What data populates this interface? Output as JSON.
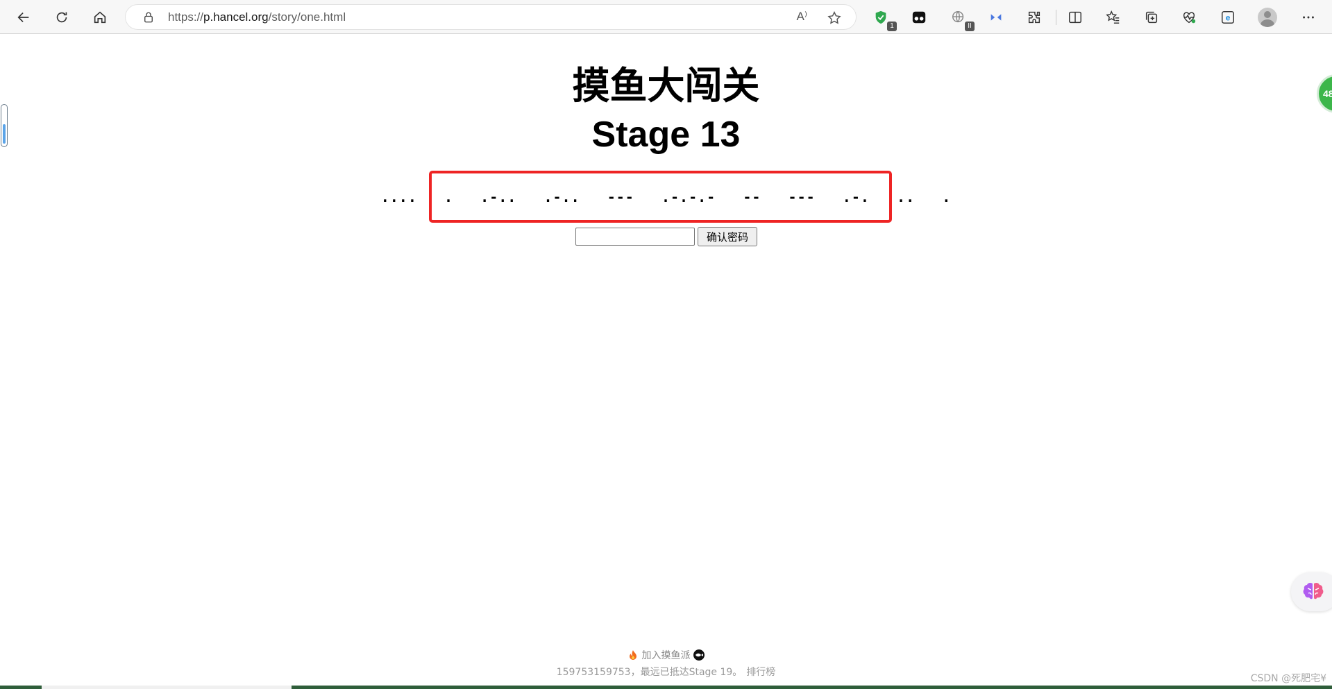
{
  "browser": {
    "url_prefix": "https://",
    "url_host": "p.hancel.org",
    "url_path": "/story/one.html",
    "read_aloud_label": "A⁾",
    "extension_badges": [
      "1",
      "II"
    ],
    "icons": [
      "back-icon",
      "refresh-icon",
      "home-icon",
      "lock-icon",
      "read-aloud-icon",
      "favorite-star-icon",
      "shield-extension-icon",
      "tampermonkey-icon",
      "translate-extension-icon",
      "sidebar-extension-icon",
      "extensions-puzzle-icon",
      "split-screen-icon",
      "favorites-icon",
      "collections-icon",
      "browser-essentials-icon",
      "edge-icon",
      "profile-avatar",
      "more-menu-icon"
    ]
  },
  "page": {
    "title_cn": "摸鱼大闯关",
    "title_stage": "Stage 13",
    "morse": "....   .   .-..   .-..   ---   .-.-.-   --   ---   .-.   ..   .",
    "password_placeholder": "",
    "confirm_button": "确认密码"
  },
  "widgets": {
    "right_badge": "48"
  },
  "footer": {
    "join_label": "加入摸鱼派",
    "info": "159753159753，最远已抵达Stage 19。",
    "leaderboard": "排行榜",
    "watermark": "CSDN @死肥宅¥"
  },
  "colors": {
    "highlight_border": "#ee2424",
    "badge_green": "#3cb64a"
  }
}
